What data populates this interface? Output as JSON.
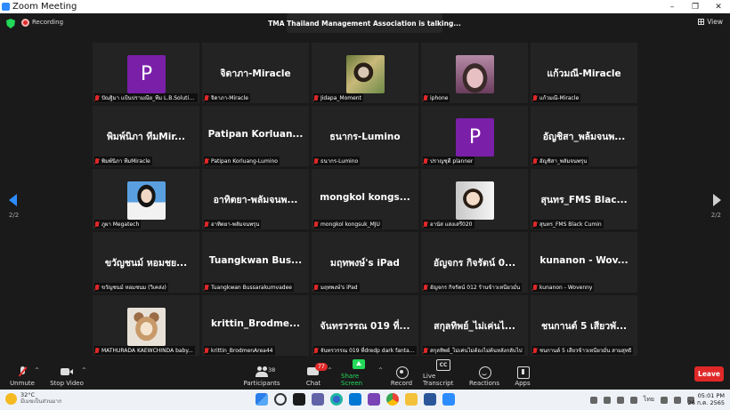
{
  "window": {
    "title": "Zoom Meeting",
    "controls": {
      "minimize": "–",
      "restore": "❐",
      "close": "✕"
    }
  },
  "status": {
    "recording_label": "Recording",
    "talking_text": "TMA Thailand Management Association is talking...",
    "view_label": "View"
  },
  "pagination": {
    "left": "2/2",
    "right": "2/2"
  },
  "tiles": [
    {
      "type": "avatar",
      "initial": "P",
      "label": "ปัณฐิมา แป้นปรามณีย_ทีม L.B.Solution ..."
    },
    {
      "type": "text",
      "big": "จิดาภา-Miracle",
      "label": "จิดาภา-Miracle"
    },
    {
      "type": "photo",
      "photo": "jidapa",
      "label": "Jidapa_Moment"
    },
    {
      "type": "photo",
      "photo": "iphone",
      "label": "iphone"
    },
    {
      "type": "text",
      "big": "แก้วมณี-Miracle",
      "label": "แก้วมณี-Miracle"
    },
    {
      "type": "text",
      "big": "พิมพ์นิภา ทีมMir...",
      "label": "พิมพ์นิภา ทีมMiracle"
    },
    {
      "type": "text",
      "big": "Patipan Korluan...",
      "label": "Patipan Korluang-Lumino"
    },
    {
      "type": "text",
      "big": "ธนากร-Lumino",
      "label": "ธนากร-Lumino"
    },
    {
      "type": "avatar",
      "initial": "P",
      "label": "ปราญชุดี planner"
    },
    {
      "type": "text",
      "big": "อัญชิสา_พล้มจนพ...",
      "label": "อัญชิสา_พลัมจนพรุน"
    },
    {
      "type": "photo",
      "photo": "megatech",
      "label": "ภูผา Megatech"
    },
    {
      "type": "text",
      "big": "อาทิตยา-พลัมจนพ...",
      "label": "อาทิตยา-พลัมจนพรุน"
    },
    {
      "type": "text",
      "big": "mongkol kongs...",
      "label": "mongkol kongsuk_MJU"
    },
    {
      "type": "photo",
      "photo": "child",
      "label": "อานัส แสงเสรี020"
    },
    {
      "type": "text",
      "big": "สุนทร_FMS Blac...",
      "label": "สุนทร_FMS Black Cumin"
    },
    {
      "type": "text",
      "big": "ขวัญชนม์ หอมชย...",
      "label": "ขวัญชนม์ หอมชนม (วิเคล่ง)"
    },
    {
      "type": "text",
      "big": "Tuangkwan Bus...",
      "label": "Tuangkwan Bussarakumvadee"
    },
    {
      "type": "text",
      "big": "มฤทพงษ์'s iPad",
      "label": "มฤทพงษ์'s iPad"
    },
    {
      "type": "text",
      "big": "อัญจกร กิจรัตน์ 0...",
      "label": "อัญจกร กิจรัตน์ 012 ร้านข้าวเหนียวมั่น"
    },
    {
      "type": "text",
      "big": "kunanon - Wov...",
      "label": "kunanon - Wovenny"
    },
    {
      "type": "photo",
      "photo": "dog",
      "label": "MATHURADA KAEWCHINDA baby..."
    },
    {
      "type": "text",
      "big": "krittin_Brodme...",
      "label": "krittin_BrodmenArea44"
    },
    {
      "type": "text",
      "big": "จันทรวรรณ 019 ที่...",
      "label": "จันทรวรรณ 019 ที่dredp dark fantacy"
    },
    {
      "type": "text",
      "big": "สกุลทิพย์_ไม่เค่นไ...",
      "label": "สกุลทิพย์_ไม่เค่นไม่ต้องไม่ค้นหลังกลับไป"
    },
    {
      "type": "text",
      "big": "ชนกานต์ 5 เสียวพั...",
      "label": "ชนกานต์ 5 เสียวข้าวเหนียวมั่น สามสุทธิ"
    }
  ],
  "toolbar": {
    "unmute": "Unmute",
    "stop_video": "Stop Video",
    "participants": "Participants",
    "participants_count": "38",
    "chat": "Chat",
    "chat_badge": "77",
    "share_screen": "Share Screen",
    "record": "Record",
    "live_transcript": "Live Transcript",
    "reactions": "Reactions",
    "apps": "Apps",
    "leave": "Leave",
    "caret": "^"
  },
  "taskbar": {
    "temperature": "32°C",
    "weather_desc": "มีเมฆเป็นส่วนมาก",
    "lang": "ไทย",
    "time": "05:01 PM",
    "date": "26 ก.ค. 2565"
  },
  "colors": {
    "accent": "#2d8cff",
    "leave": "#e02828",
    "share": "#23d959",
    "avatar_purple": "#7a1fa8"
  }
}
